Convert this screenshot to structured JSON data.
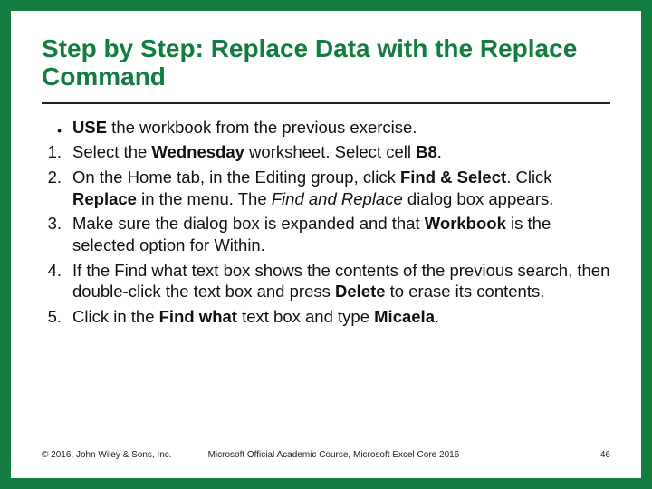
{
  "title": "Step by Step: Replace Data with the Replace Command",
  "items": [
    {
      "marker": "•",
      "html": "<b>USE</b> the workbook from the previous exercise."
    },
    {
      "marker": "1.",
      "html": "Select the <b>Wednesday</b> worksheet. Select cell <b>B8</b>."
    },
    {
      "marker": "2.",
      "html": "On the Home tab, in the Editing group, click <b>Find & Select</b>. Click <b>Replace</b> in the menu. The <i>Find and Replace</i> dialog box appears."
    },
    {
      "marker": "3.",
      "html": "Make sure the dialog box is expanded and that <b>Workbook</b> is the selected option for Within."
    },
    {
      "marker": "4.",
      "html": "If the Find what text box shows the contents of the previous search, then double-click the text box and press <b>Delete</b> to erase its contents."
    },
    {
      "marker": "5.",
      "html": "Click in the <b>Find what</b> text box and type <b>Micaela</b>."
    }
  ],
  "footer": {
    "copyright": "© 2016, John Wiley & Sons, Inc.",
    "course": "Microsoft Official Academic Course, Microsoft Excel Core 2016",
    "page": "46"
  }
}
